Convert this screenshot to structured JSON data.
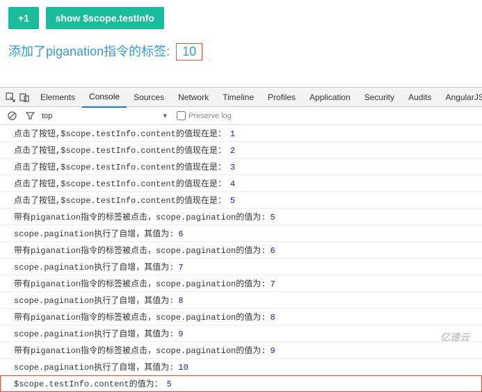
{
  "top": {
    "btn_plus": "+1",
    "btn_show": "show $scope.testInfo",
    "label_prefix": "添加了piganation指令的标签:",
    "label_value": "10"
  },
  "devtools": {
    "tabs": [
      "Elements",
      "Console",
      "Sources",
      "Network",
      "Timeline",
      "Profiles",
      "Application",
      "Security",
      "Audits",
      "AngularJS"
    ],
    "active_tab": "Console"
  },
  "toolbar": {
    "context": "top",
    "preserve_log": "Preserve log",
    "preserve_checked": false
  },
  "console": [
    {
      "msg": "点击了按钮,$scope.testInfo.content的值现在是：",
      "num": "1"
    },
    {
      "msg": "点击了按钮,$scope.testInfo.content的值现在是：",
      "num": "2"
    },
    {
      "msg": "点击了按钮,$scope.testInfo.content的值现在是：",
      "num": "3"
    },
    {
      "msg": "点击了按钮,$scope.testInfo.content的值现在是：",
      "num": "4"
    },
    {
      "msg": "点击了按钮,$scope.testInfo.content的值现在是：",
      "num": "5"
    },
    {
      "msg": "带有piganation指令的标签被点击，scope.pagination的值为:",
      "num": "5"
    },
    {
      "msg": "scope.pagination执行了自增，其值为:",
      "num": "6"
    },
    {
      "msg": "带有piganation指令的标签被点击，scope.pagination的值为:",
      "num": "6"
    },
    {
      "msg": "scope.pagination执行了自增，其值为:",
      "num": "7"
    },
    {
      "msg": "带有piganation指令的标签被点击，scope.pagination的值为:",
      "num": "7"
    },
    {
      "msg": "scope.pagination执行了自增，其值为:",
      "num": "8"
    },
    {
      "msg": "带有piganation指令的标签被点击，scope.pagination的值为:",
      "num": "8"
    },
    {
      "msg": "scope.pagination执行了自增，其值为:",
      "num": "9"
    },
    {
      "msg": "带有piganation指令的标签被点击，scope.pagination的值为:",
      "num": "9"
    },
    {
      "msg": "scope.pagination执行了自增，其值为:",
      "num": "10"
    },
    {
      "msg": "$scope.testInfo.content的值为：",
      "num": "5",
      "highlight": true
    }
  ],
  "watermark": "亿速云"
}
